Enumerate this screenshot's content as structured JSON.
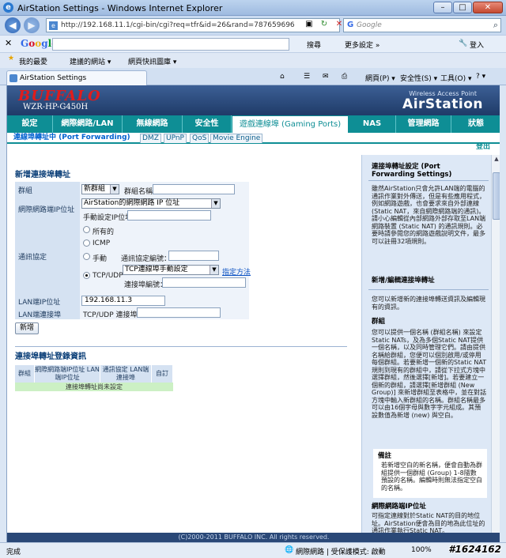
{
  "window": {
    "title": "AirStation Settings - Windows Internet Explorer",
    "url": "http://192.168.11.1/cgi-bin/cgi?req=tfr&id=26&rand=787659696",
    "search_placeholder": "Google",
    "min": "–",
    "max": "□",
    "close": "✕"
  },
  "google_toolbar": {
    "logo": [
      "G",
      "o",
      "o",
      "g",
      "l",
      "e"
    ],
    "search_label": "搜尋",
    "more_label": "更多設定 »",
    "login_label": "登入"
  },
  "favorites": {
    "fav_label": "我的最愛",
    "item1": "建議的網站 ▾",
    "item2": "網頁快訊圖庫 ▾"
  },
  "tab": {
    "label": "AirStation Settings",
    "page_menu": "網頁(P) ▾",
    "safety_menu": "安全性(S) ▾",
    "tools_menu": "工具(O) ▾",
    "help_menu": "? ▾"
  },
  "brand": {
    "logo": "BUFFALO",
    "model": "WZR-HP-G450H",
    "tagline": "Wireless Access Point",
    "product": "AirStation"
  },
  "main_nav": [
    {
      "label": "設定"
    },
    {
      "label": "網際網路/LAN"
    },
    {
      "label": "無線網路"
    },
    {
      "label": "安全性"
    },
    {
      "label": "遊戲連線埠 (Gaming Ports)"
    },
    {
      "label": "NAS"
    },
    {
      "label": "管理網路"
    },
    {
      "label": "狀態"
    }
  ],
  "sub_nav": [
    {
      "label": "連線埠轉址中 (Port Forwarding)"
    },
    {
      "label": "DMZ"
    },
    {
      "label": "UPnP"
    },
    {
      "label": "QoS"
    },
    {
      "label": "Movie Engine"
    }
  ],
  "logout": "登出",
  "form": {
    "title": "新增連接埠轉址",
    "group_label": "群組",
    "group_select": "新群組",
    "group_name_label": "群組名稱",
    "wan_ip_label": "網際網路端IP位址",
    "wan_ip_select": "AirStation的網際網路 IP 位址",
    "manual_ip_label": "手動設定IP位址",
    "protocol_label": "通訊協定",
    "proto_all": "所有的",
    "proto_icmp": "ICMP",
    "proto_manual": "手動",
    "proto_manual_field": "通訊協定編號：",
    "proto_tcpudp": "TCP/UDP",
    "tcpudp_select": "TCP連線埠手動設定",
    "specify_link": "指定方法",
    "port_label": "連接埠編號：",
    "lan_ip_label": "LAN端IP位址",
    "lan_ip_value": "192.168.11.3",
    "lan_port_label": "LAN端連接埠",
    "lan_port_field": "TCP/UDP 連接埠：",
    "add_button": "新增"
  },
  "list": {
    "title": "連接埠轉址登錄資訊",
    "headers": [
      "群組",
      "網際網路端IP位址 LAN端IP位址",
      "通訊協定 LAN端連接埠",
      "自訂"
    ],
    "empty": "連接埠轉址尚未設定"
  },
  "help": {
    "title": "連接埠轉址設定 (Port Forwarding Settings)",
    "intro": "雖然AirStation只會允許LAN端的電腦的通訊作業對外傳送，但是有些應用程式，例如網路遊戲，也會要求來自外部連線 (Static NAT，來自網際網路端的通訊)。請小心編輯從內部網路外部存取至LAN端網路裝置 (Static NAT) 的通訊規則。必要時請參閱您的網路遊戲說明文件，最多可以註冊32項規則。",
    "section2": "新增/編輯連接埠轉址",
    "section2_text": "您可以新增新的連接埠轉送資訊及編輯現有的資訊。",
    "group_title": "群組",
    "group_text": "您可以提供一個名稱 (群組名稱) 來設定Static NATs，及為多個Static NAT提供一個名稱，以及同時管理它們。請由提供名稱給群組，您便可以個別啟用/或停用每個群組。若要新增一個新的Static NAT規則到現有的群組中，請從下拉式方塊中選擇群組，然後選擇[新增]。若要建立一個新的群組，請選擇[新增群組 (New Group)] 來新增群組至表格中，並在對話方塊中輸入新群組的名稱。群組名稱最多可以由16個字母與數字字元組成。其預設數值為新增 (new) 與空白。",
    "note_title": "備註",
    "note_text": "若新增空白的新名稱，便會自動為群組提供一個群組 (Group) 1-8隨數預設的名稱。編輯時則無法指定空白的名稱。",
    "wan_title": "網際網路端IP位址",
    "wan_text": "可指定連線對於Static NAT的目的地位址。AirStation便會為目的地為此位址的通訊作業執行Static NAT。"
  },
  "footer": "(C)2000-2011 BUFFALO INC. All rights reserved.",
  "status": {
    "left": "完成",
    "zone": "網際網路 | 受保護模式: 啟動",
    "zoom": "100%"
  },
  "watermark": "#1624162"
}
